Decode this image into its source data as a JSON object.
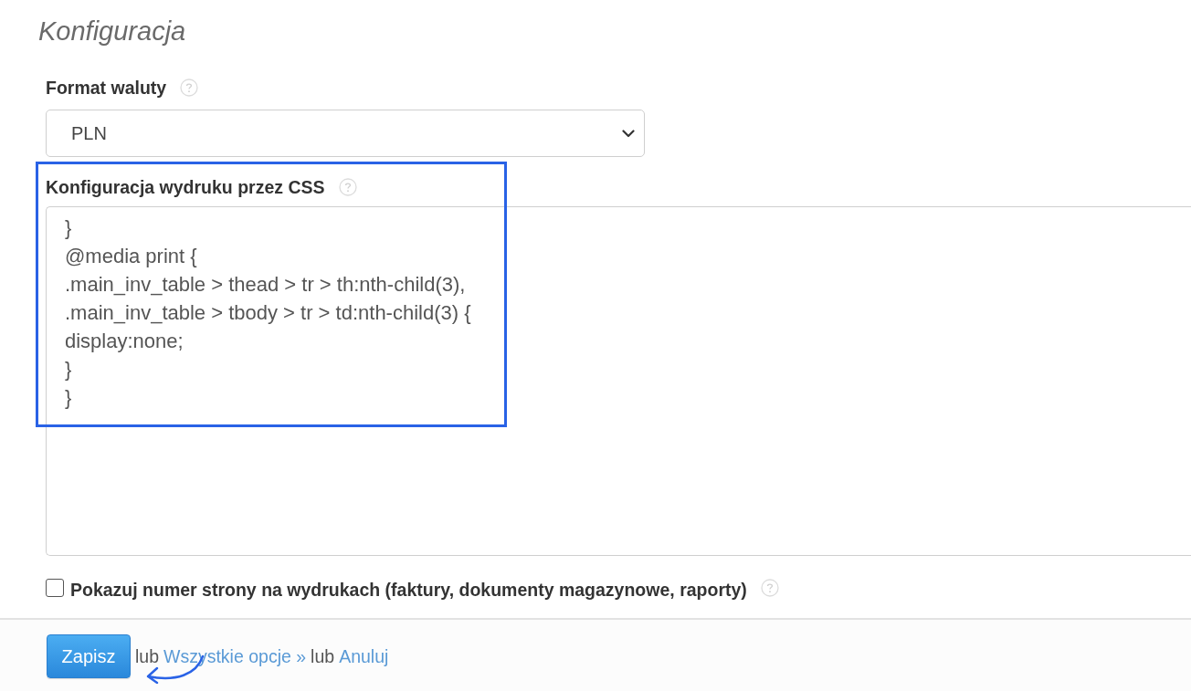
{
  "title": "Konfiguracja",
  "fields": [
    {
      "kind": "select",
      "label": "Format waluty",
      "value": "PLN",
      "highlighted": false
    },
    {
      "kind": "textarea",
      "label": "Konfiguracja wydruku przez CSS",
      "value": "}\n@media print {\n.main_inv_table > thead > tr > th:nth-child(3),\n.main_inv_table > tbody > tr > td:nth-child(3) {\ndisplay:none;\n}\n}",
      "highlighted": true
    },
    {
      "kind": "checkbox",
      "label": "Pokazuj numer strony na wydrukach (faktury, dokumenty magazynowe, raporty)",
      "checked": false,
      "highlighted": false
    }
  ],
  "footer": {
    "save_button": "Zapisz",
    "items": [
      {
        "kind": "text",
        "text": "lub"
      },
      {
        "kind": "link",
        "text": "Wszystkie opcje »"
      },
      {
        "kind": "text",
        "text": "lub"
      },
      {
        "kind": "link",
        "text": "Anuluj"
      }
    ]
  }
}
